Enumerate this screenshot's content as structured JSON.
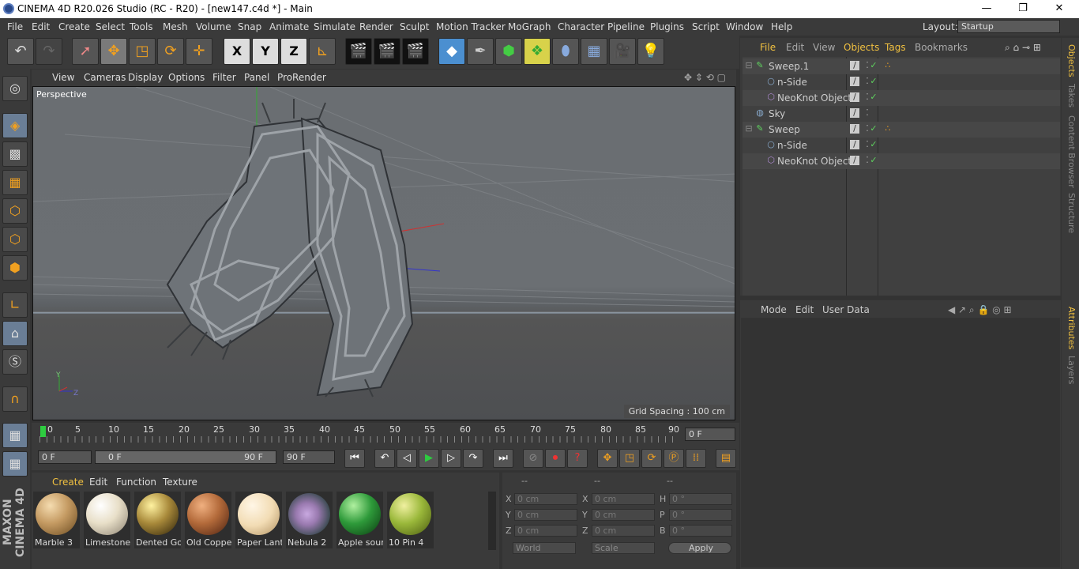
{
  "window": {
    "title": "CINEMA 4D R20.026 Studio (RC - R20) - [new147.c4d *] - Main",
    "controls": [
      "—",
      "❐",
      "✕"
    ]
  },
  "menubar": {
    "items": [
      "File",
      "Edit",
      "Create",
      "Select",
      "Tools",
      "Mesh",
      "Volume",
      "Snap",
      "Animate",
      "Simulate",
      "Render",
      "Sculpt",
      "Motion Tracker",
      "MoGraph",
      "Character",
      "Pipeline",
      "Plugins",
      "Script",
      "Window",
      "Help"
    ],
    "layout_label": "Layout:",
    "layout_value": "Startup"
  },
  "toolbar": {
    "axis_x": "X",
    "axis_y": "Y",
    "axis_z": "Z"
  },
  "viewport": {
    "menu": [
      "View",
      "Cameras",
      "Display",
      "Options",
      "Filter",
      "Panel",
      "ProRender"
    ],
    "camera_label": "Perspective",
    "grid_spacing": "Grid Spacing : 100 cm",
    "axis_y": "Y",
    "axis_z": "Z"
  },
  "timeline": {
    "ticks": [
      "0",
      "5",
      "10",
      "15",
      "20",
      "25",
      "30",
      "35",
      "40",
      "45",
      "50",
      "55",
      "60",
      "65",
      "70",
      "75",
      "80",
      "85",
      "90"
    ],
    "current_frame": "0 F",
    "start_frame": "0 F",
    "range_start": "0 F",
    "range_end": "90 F",
    "end_frame": "90 F"
  },
  "materials": {
    "menu": [
      "Create",
      "Edit",
      "Function",
      "Texture"
    ],
    "items": [
      {
        "name": "Marble 3",
        "color": "#c49a62"
      },
      {
        "name": "Limestone",
        "color": "#e8dfc8"
      },
      {
        "name": "Dented Go",
        "color": "#a8893a"
      },
      {
        "name": "Old Coppe",
        "color": "#b36a3a"
      },
      {
        "name": "Paper Lant",
        "color": "#f2dcb4"
      },
      {
        "name": "Nebula 2",
        "color": "#9a7ab0"
      },
      {
        "name": "Apple sour",
        "color": "#2e9a3a"
      },
      {
        "name": "10 Pin 4",
        "color": "#9ab83a"
      }
    ]
  },
  "coordinates": {
    "headers": [
      "--",
      "--",
      "--"
    ],
    "rows": [
      {
        "a": "X",
        "av": "0 cm",
        "b": "X",
        "bv": "0 cm",
        "c": "H",
        "cv": "0 °"
      },
      {
        "a": "Y",
        "av": "0 cm",
        "b": "Y",
        "bv": "0 cm",
        "c": "P",
        "cv": "0 °"
      },
      {
        "a": "Z",
        "av": "0 cm",
        "b": "Z",
        "bv": "0 cm",
        "c": "B",
        "cv": "0 °"
      }
    ],
    "mode1": "World",
    "mode2": "Scale",
    "apply": "Apply"
  },
  "objects": {
    "menu": [
      "File",
      "Edit",
      "View",
      "Objects",
      "Tags",
      "Bookmarks"
    ],
    "rows": [
      {
        "name": "Sweep.1",
        "indent": 0,
        "icon": "sweep-icon",
        "check": "✓",
        "tag": true
      },
      {
        "name": "n-Side",
        "indent": 1,
        "icon": "circle-spline-icon",
        "check": "✓",
        "tag": false
      },
      {
        "name": "NeoKnot Object",
        "indent": 1,
        "icon": "neoknot-icon",
        "check": "✓",
        "tag": false
      },
      {
        "name": "Sky",
        "indent": 0,
        "icon": "sky-icon",
        "check": "",
        "tag": false
      },
      {
        "name": "Sweep",
        "indent": 0,
        "icon": "sweep-icon",
        "check": "✓",
        "tag": true
      },
      {
        "name": "n-Side",
        "indent": 1,
        "icon": "circle-spline-icon",
        "check": "✓",
        "tag": false
      },
      {
        "name": "NeoKnot Object",
        "indent": 1,
        "icon": "neoknot-icon",
        "check": "✓",
        "tag": false
      }
    ]
  },
  "attributes": {
    "menu": [
      "Mode",
      "Edit",
      "User Data"
    ]
  },
  "right_tabs": [
    "Objects",
    "Takes",
    "Content Browser",
    "Structure",
    "Attributes",
    "Layers"
  ],
  "branding": "MAXON CINEMA 4D",
  "colors": {
    "accent": "#f0c040",
    "check": "#5fd35f"
  }
}
